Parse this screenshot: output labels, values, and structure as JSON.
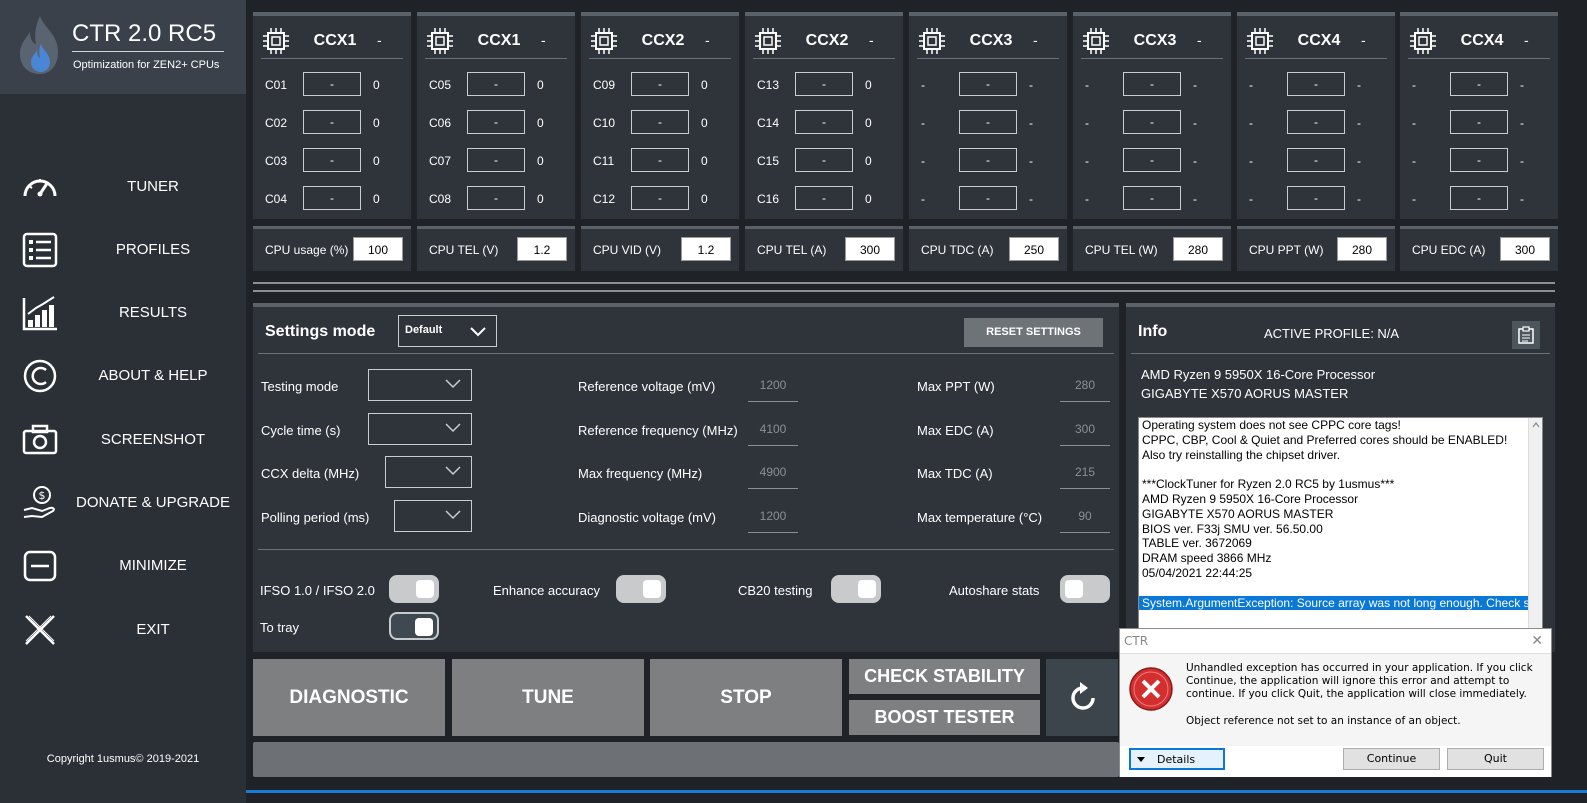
{
  "app": {
    "title": "CTR 2.0 RC5",
    "subtitle": "Optimization for ZEN2+ CPUs",
    "copyright": "Copyright 1usmus© 2019-2021"
  },
  "sidebar": {
    "items": [
      {
        "label": "TUNER",
        "icon": "gauge-icon"
      },
      {
        "label": "PROFILES",
        "icon": "list-icon"
      },
      {
        "label": "RESULTS",
        "icon": "chart-icon"
      },
      {
        "label": "ABOUT & HELP",
        "icon": "copyright-icon"
      },
      {
        "label": "SCREENSHOT",
        "icon": "camera-icon"
      },
      {
        "label": "DONATE & UPGRADE",
        "icon": "donate-icon"
      },
      {
        "label": "MINIMIZE",
        "icon": "minimize-icon"
      },
      {
        "label": "EXIT",
        "icon": "close-icon"
      }
    ]
  },
  "ccx": [
    {
      "name": "CCX1",
      "status": "-",
      "cores": [
        {
          "label": "C01",
          "box": "-",
          "value": "0"
        },
        {
          "label": "C02",
          "box": "-",
          "value": "0"
        },
        {
          "label": "C03",
          "box": "-",
          "value": "0"
        },
        {
          "label": "C04",
          "box": "-",
          "value": "0"
        }
      ]
    },
    {
      "name": "CCX1",
      "status": "-",
      "cores": [
        {
          "label": "C05",
          "box": "-",
          "value": "0"
        },
        {
          "label": "C06",
          "box": "-",
          "value": "0"
        },
        {
          "label": "C07",
          "box": "-",
          "value": "0"
        },
        {
          "label": "C08",
          "box": "-",
          "value": "0"
        }
      ]
    },
    {
      "name": "CCX2",
      "status": "-",
      "cores": [
        {
          "label": "C09",
          "box": "-",
          "value": "0"
        },
        {
          "label": "C10",
          "box": "-",
          "value": "0"
        },
        {
          "label": "C11",
          "box": "-",
          "value": "0"
        },
        {
          "label": "C12",
          "box": "-",
          "value": "0"
        }
      ]
    },
    {
      "name": "CCX2",
      "status": "-",
      "cores": [
        {
          "label": "C13",
          "box": "-",
          "value": "0"
        },
        {
          "label": "C14",
          "box": "-",
          "value": "0"
        },
        {
          "label": "C15",
          "box": "-",
          "value": "0"
        },
        {
          "label": "C16",
          "box": "-",
          "value": "0"
        }
      ]
    },
    {
      "name": "CCX3",
      "status": "-",
      "cores": [
        {
          "label": "-",
          "box": "-",
          "value": "-"
        },
        {
          "label": "-",
          "box": "-",
          "value": "-"
        },
        {
          "label": "-",
          "box": "-",
          "value": "-"
        },
        {
          "label": "-",
          "box": "-",
          "value": "-"
        }
      ]
    },
    {
      "name": "CCX3",
      "status": "-",
      "cores": [
        {
          "label": "-",
          "box": "-",
          "value": "-"
        },
        {
          "label": "-",
          "box": "-",
          "value": "-"
        },
        {
          "label": "-",
          "box": "-",
          "value": "-"
        },
        {
          "label": "-",
          "box": "-",
          "value": "-"
        }
      ]
    },
    {
      "name": "CCX4",
      "status": "-",
      "cores": [
        {
          "label": "-",
          "box": "-",
          "value": "-"
        },
        {
          "label": "-",
          "box": "-",
          "value": "-"
        },
        {
          "label": "-",
          "box": "-",
          "value": "-"
        },
        {
          "label": "-",
          "box": "-",
          "value": "-"
        }
      ]
    },
    {
      "name": "CCX4",
      "status": "-",
      "cores": [
        {
          "label": "-",
          "box": "-",
          "value": "-"
        },
        {
          "label": "-",
          "box": "-",
          "value": "-"
        },
        {
          "label": "-",
          "box": "-",
          "value": "-"
        },
        {
          "label": "-",
          "box": "-",
          "value": "-"
        }
      ]
    }
  ],
  "stats": [
    {
      "label": "CPU usage (%)",
      "value": "100"
    },
    {
      "label": "CPU TEL (V)",
      "value": "1.2"
    },
    {
      "label": "CPU VID (V)",
      "value": "1.2"
    },
    {
      "label": "CPU TEL (A)",
      "value": "300"
    },
    {
      "label": "CPU TDC (A)",
      "value": "250"
    },
    {
      "label": "CPU TEL (W)",
      "value": "280"
    },
    {
      "label": "CPU PPT (W)",
      "value": "280"
    },
    {
      "label": "CPU EDC (A)",
      "value": "300"
    }
  ],
  "settings": {
    "title": "Settings mode",
    "mode_value": "Default",
    "reset_label": "RESET SETTINGS",
    "left": [
      {
        "label": "Testing mode"
      },
      {
        "label": "Cycle time (s)"
      },
      {
        "label": "CCX delta (MHz)"
      },
      {
        "label": "Polling period (ms)"
      }
    ],
    "middle": [
      {
        "label": "Reference voltage (mV)",
        "value": "1200"
      },
      {
        "label": "Reference frequency (MHz)",
        "value": "4100"
      },
      {
        "label": "Max frequency (MHz)",
        "value": "4900"
      },
      {
        "label": "Diagnostic voltage (mV)",
        "value": "1200"
      }
    ],
    "right": [
      {
        "label": "Max PPT (W)",
        "value": "280"
      },
      {
        "label": "Max EDC (A)",
        "value": "300"
      },
      {
        "label": "Max TDC (A)",
        "value": "215"
      },
      {
        "label": "Max temperature (°C)",
        "value": "90"
      }
    ],
    "toggles": {
      "ifso": "IFSO 1.0 / IFSO 2.0",
      "enhance": "Enhance accuracy",
      "cb20": "CB20 testing",
      "autoshare": "Autoshare stats",
      "tray": "To tray"
    }
  },
  "buttons": {
    "diagnostic": "DIAGNOSTIC",
    "tune": "TUNE",
    "stop": "STOP",
    "check_stability": "CHECK STABILITY",
    "boost_tester": "BOOST TESTER"
  },
  "info": {
    "title": "Info",
    "active_profile": "ACTIVE PROFILE: N/A",
    "cpu": "AMD Ryzen 9 5950X 16-Core Processor",
    "board": "GIGABYTE X570 AORUS MASTER",
    "log": [
      "Operating system does not see CPPC core tags!",
      "CPPC, CBP, Cool & Quiet and Preferred cores should be ENABLED!",
      "Also try reinstalling the chipset driver.",
      "",
      "***ClockTuner for Ryzen 2.0 RC5 by 1usmus***",
      "AMD Ryzen 9 5950X 16-Core Processor",
      "GIGABYTE X570 AORUS MASTER",
      "BIOS ver. F33j SMU ver. 56.50.00",
      "TABLE ver. 3672069",
      "DRAM speed 3866 MHz",
      "05/04/2021 22:44:25",
      "",
      "System.ArgumentException: Source array was not long enough. Check s"
    ]
  },
  "dialog": {
    "title": "CTR",
    "message": "Unhandled exception has occurred in your application. If you click Continue, the application will ignore this error and attempt to continue. If you click Quit, the application will close immediately.",
    "detail": "Object reference not set to an instance of an object.",
    "details_label": "Details",
    "continue_label": "Continue",
    "quit_label": "Quit"
  },
  "colors": {
    "background": "#1f2327",
    "panel": "#2f343a",
    "sidebar": "#2b3036",
    "button_gray": "#7d7f81",
    "selection_blue": "#0a78d7",
    "error_red": "#d32f2f"
  }
}
